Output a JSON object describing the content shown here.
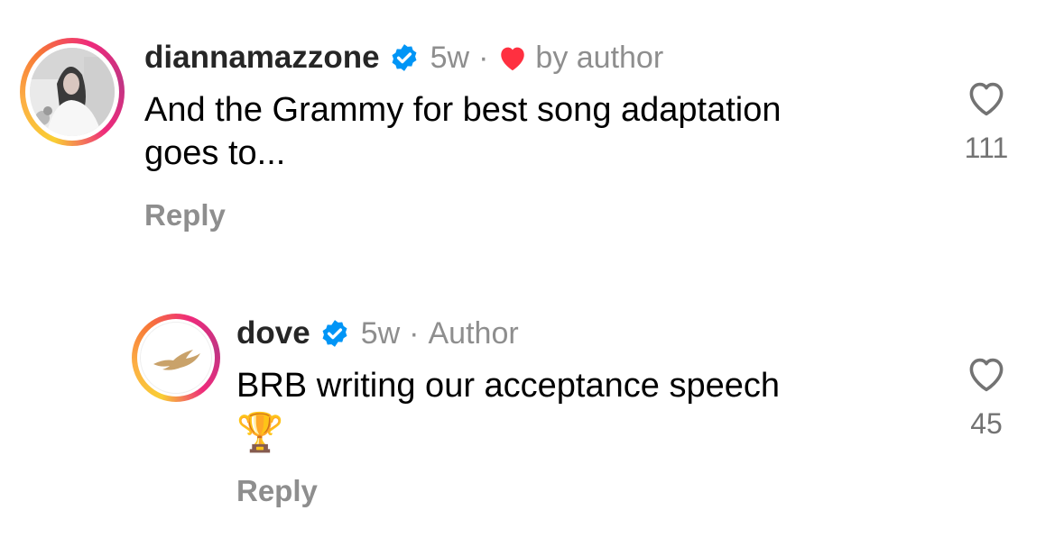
{
  "comments": [
    {
      "username": "diannamazzone",
      "time": "5w",
      "separator": "·",
      "liked_by_author_label": "by author",
      "text_line1": "And the Grammy for best song adaptation",
      "text_line2": "goes to...",
      "reply_label": "Reply",
      "like_count": "111"
    },
    {
      "username": "dove",
      "time": "5w",
      "separator": "·",
      "author_label": "Author",
      "text_line1": "BRB writing our acceptance speech",
      "emoji": "🏆",
      "reply_label": "Reply",
      "like_count": "45"
    }
  ],
  "colors": {
    "verified_blue": "#0095f6",
    "heart_red": "#ff3040",
    "text_dark": "#262626",
    "text_muted": "#8e8e8e"
  }
}
